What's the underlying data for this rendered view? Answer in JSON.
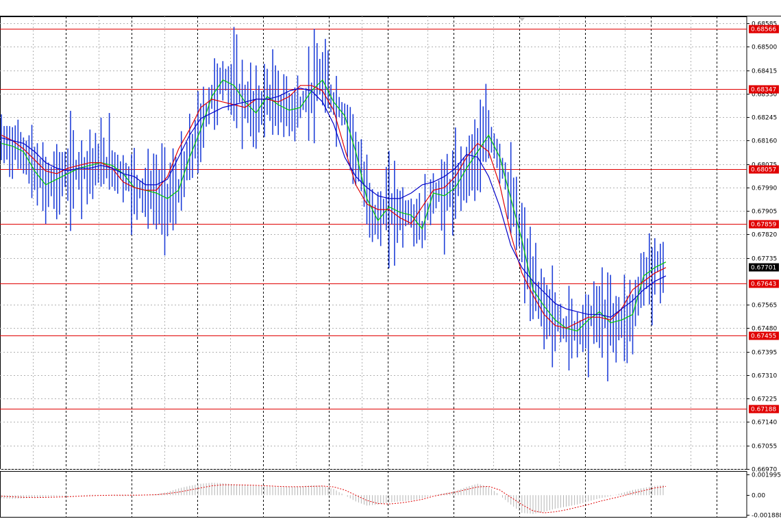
{
  "chart_data": [
    {
      "type": "candlestick",
      "title": "",
      "y_ticks": [
        "0.68585",
        "0.68500",
        "0.68415",
        "0.68330",
        "0.68245",
        "0.68160",
        "0.68075",
        "0.67990",
        "0.67905",
        "0.67820",
        "0.67735",
        "0.67565",
        "0.67480",
        "0.67395",
        "0.67310",
        "0.67225",
        "0.67140",
        "0.67055",
        "0.66970"
      ],
      "ylim": [
        0.6697,
        0.6861
      ],
      "current_price": "0.67701",
      "horizontal_levels": [
        "0.68566",
        "0.68347",
        "0.68057",
        "0.67859",
        "0.67643",
        "0.67455",
        "0.67188"
      ],
      "series": [
        {
          "name": "",
          "color": "#00c800",
          "values": [
            0.6815,
            0.6814,
            0.6812,
            0.6805,
            0.68,
            0.6802,
            0.6804,
            0.6806,
            0.6807,
            0.6808,
            0.6807,
            0.6804,
            0.6799,
            0.6798,
            0.6797,
            0.6795,
            0.6798,
            0.681,
            0.682,
            0.6832,
            0.6838,
            0.6836,
            0.683,
            0.6826,
            0.6832,
            0.6829,
            0.6827,
            0.6828,
            0.6834,
            0.6838,
            0.683,
            0.6825,
            0.6812,
            0.6795,
            0.6787,
            0.6792,
            0.679,
            0.6789,
            0.6784,
            0.6797,
            0.6796,
            0.6799,
            0.6806,
            0.6812,
            0.6818,
            0.681,
            0.6795,
            0.678,
            0.6762,
            0.6756,
            0.6751,
            0.6748,
            0.6747,
            0.6751,
            0.6754,
            0.675,
            0.6751,
            0.6753,
            0.6767,
            0.677,
            0.6772
          ]
        },
        {
          "name": "",
          "color": "#e00000",
          "values": [
            0.6818,
            0.6816,
            0.6813,
            0.6809,
            0.6805,
            0.6804,
            0.6806,
            0.6807,
            0.6808,
            0.6808,
            0.6806,
            0.6801,
            0.6799,
            0.6798,
            0.6798,
            0.6803,
            0.6813,
            0.682,
            0.6828,
            0.6831,
            0.683,
            0.6829,
            0.6828,
            0.6831,
            0.6831,
            0.683,
            0.6832,
            0.6836,
            0.6836,
            0.6834,
            0.6827,
            0.6813,
            0.68,
            0.6793,
            0.6791,
            0.6791,
            0.6788,
            0.6786,
            0.6792,
            0.6798,
            0.6799,
            0.6803,
            0.681,
            0.6815,
            0.6812,
            0.68,
            0.6782,
            0.6768,
            0.676,
            0.6753,
            0.6749,
            0.6748,
            0.675,
            0.6752,
            0.6752,
            0.6751,
            0.6755,
            0.6762,
            0.6765,
            0.6768,
            0.677
          ]
        },
        {
          "name": "",
          "color": "#0000c8",
          "values": [
            0.6817,
            0.6816,
            0.6815,
            0.6812,
            0.6808,
            0.6806,
            0.6805,
            0.6806,
            0.6806,
            0.6807,
            0.6806,
            0.6804,
            0.6803,
            0.68,
            0.68,
            0.6802,
            0.681,
            0.6818,
            0.6824,
            0.6826,
            0.6828,
            0.6829,
            0.683,
            0.6831,
            0.6831,
            0.6832,
            0.6834,
            0.6835,
            0.6834,
            0.683,
            0.6822,
            0.681,
            0.6803,
            0.6799,
            0.6796,
            0.6795,
            0.6795,
            0.6797,
            0.68,
            0.6801,
            0.6803,
            0.6806,
            0.6811,
            0.681,
            0.6803,
            0.6792,
            0.6778,
            0.677,
            0.6765,
            0.6761,
            0.6757,
            0.6755,
            0.6754,
            0.6753,
            0.6753,
            0.6752,
            0.6755,
            0.6758,
            0.6762,
            0.6765,
            0.6767
          ]
        }
      ]
    },
    {
      "type": "bar",
      "title": "",
      "y_ticks": [
        "0.001995",
        "0.00",
        "-0.001888"
      ],
      "ylim": [
        -0.001888,
        0.001995
      ],
      "series": [
        {
          "name": "",
          "color": "#b4b4b4",
          "values": [
            -0.0003,
            -0.00035,
            -0.0003,
            -0.0002,
            -0.00015,
            -0.0001,
            -5e-05,
            0.0,
            5e-05,
            2e-05,
            -5e-05,
            -0.0001,
            -5e-05,
            0.0,
            0.0001,
            0.0003,
            0.00065,
            0.0009,
            0.0011,
            0.0012,
            0.00115,
            0.00105,
            0.00095,
            0.0009,
            0.00085,
            0.0008,
            0.0008,
            0.00085,
            0.00095,
            0.0009,
            0.0006,
            0.0,
            -0.0006,
            -0.001,
            -0.0009,
            -0.0007,
            -0.0006,
            -0.0005,
            -0.0003,
            0.0,
            0.0002,
            0.0004,
            0.0008,
            0.0011,
            0.0008,
            0.0,
            -0.0009,
            -0.0017,
            -0.0018,
            -0.0016,
            -0.0013,
            -0.0011,
            -0.0009,
            -0.0006,
            -0.0003,
            -0.0001,
            0.0002,
            0.0005,
            0.0007,
            0.0009,
            0.001
          ]
        },
        {
          "name": "",
          "color": "#e00000",
          "values": [
            -0.0001,
            -0.00015,
            -0.0002,
            -0.00022,
            -0.0002,
            -0.00018,
            -0.00015,
            -0.0001,
            -5e-05,
            -2e-05,
            0.0,
            0.0,
            0.0,
            2e-05,
            5e-05,
            0.00015,
            0.0003,
            0.0005,
            0.0007,
            0.0009,
            0.001,
            0.001,
            0.00098,
            0.00095,
            0.0009,
            0.00085,
            0.00082,
            0.00082,
            0.00085,
            0.00088,
            0.0008,
            0.0005,
            0.0,
            -0.0005,
            -0.0008,
            -0.00085,
            -0.00075,
            -0.0006,
            -0.0004,
            -0.0001,
            0.0001,
            0.0003,
            0.00055,
            0.0008,
            0.00085,
            0.0005,
            -0.0002,
            -0.0009,
            -0.0015,
            -0.0017,
            -0.0016,
            -0.0014,
            -0.00115,
            -0.0009,
            -0.0006,
            -0.00035,
            -0.0001,
            0.0002,
            0.00045,
            0.0007,
            0.00085
          ]
        }
      ]
    }
  ]
}
